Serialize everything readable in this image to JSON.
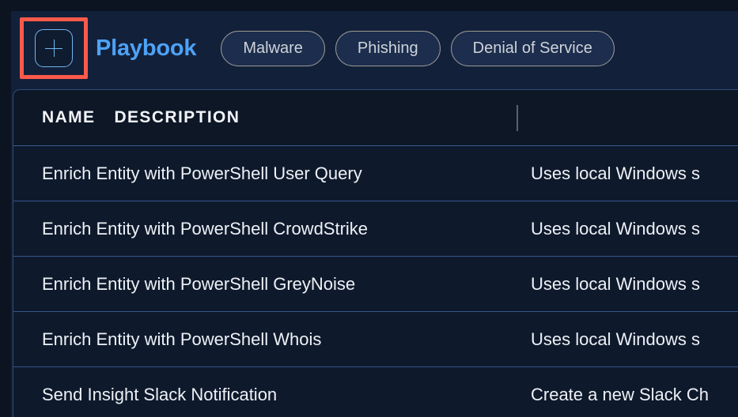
{
  "header": {
    "add_button_icon": "plus-icon",
    "title": "Playbook",
    "chips": [
      {
        "label": "Malware"
      },
      {
        "label": "Phishing"
      },
      {
        "label": "Denial of Service"
      }
    ]
  },
  "colors": {
    "page_background": "#13203a",
    "panel_background": "#0d1726",
    "row_background": "#0e1a2c",
    "title_accent": "#4da2f5",
    "highlight_border": "#fc5a4b",
    "row_divider": "#33548a",
    "chip_border": "#9b9a94",
    "chip_fill": "#1c2d4d"
  },
  "table": {
    "columns": [
      {
        "label": "NAME"
      },
      {
        "label": "DESCRIPTION"
      }
    ],
    "rows": [
      {
        "name": "Enrich Entity with PowerShell User Query",
        "description": "Uses local Windows s"
      },
      {
        "name": "Enrich Entity with PowerShell CrowdStrike",
        "description": "Uses local Windows s"
      },
      {
        "name": "Enrich Entity with PowerShell GreyNoise",
        "description": "Uses local Windows s"
      },
      {
        "name": "Enrich Entity with PowerShell Whois",
        "description": "Uses local Windows s"
      },
      {
        "name": "Send Insight Slack Notification",
        "description": "Create a new Slack Ch"
      }
    ]
  }
}
